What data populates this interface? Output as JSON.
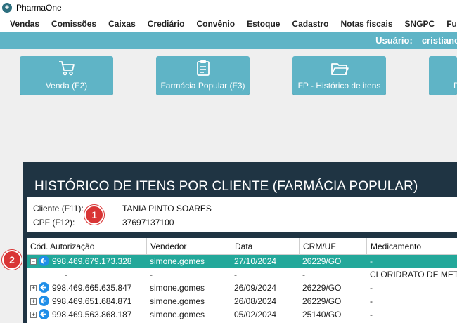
{
  "window": {
    "title": "PharmaOne"
  },
  "menu": [
    "Vendas",
    "Comissões",
    "Caixas",
    "Crediário",
    "Convênio",
    "Estoque",
    "Cadastro",
    "Notas fiscais",
    "SNGPC",
    "Funções a"
  ],
  "userbar": {
    "label": "Usuário:",
    "value": "cristiano"
  },
  "toolbar": {
    "buttons": [
      {
        "label": "Venda (F2)",
        "icon": "cart-icon"
      },
      {
        "label": "Farmácia Popular (F3)",
        "icon": "clipboard-icon"
      },
      {
        "label": "FP - Histórico de itens",
        "icon": "folder-icon"
      },
      {
        "label": "D",
        "icon": ""
      }
    ]
  },
  "panel": {
    "title": "HISTÓRICO DE ITENS POR CLIENTE (FARMÁCIA POPULAR)",
    "cliente_label": "Cliente (F11):",
    "cliente_value": "TANIA PINTO SOARES",
    "cpf_label": "CPF (F12):",
    "cpf_value": "37697137100"
  },
  "grid": {
    "columns": [
      "Cód. Autorização",
      "Vendedor",
      "Data",
      "CRM/UF",
      "Medicamento"
    ],
    "rows": [
      {
        "expander": "−",
        "cod": "998.469.679.173.328",
        "vendedor": "simone.gomes",
        "data": "27/10/2024",
        "crm": "26229/GO",
        "med": "-"
      },
      {
        "expander": "",
        "cod": "-",
        "vendedor": "-",
        "data": "-",
        "crm": "-",
        "med": "CLORIDRATO DE METFO"
      },
      {
        "expander": "+",
        "cod": "998.469.665.635.847",
        "vendedor": "simone.gomes",
        "data": "26/09/2024",
        "crm": "26229/GO",
        "med": "-"
      },
      {
        "expander": "+",
        "cod": "998.469.651.684.871",
        "vendedor": "simone.gomes",
        "data": "26/08/2024",
        "crm": "26229/GO",
        "med": "-"
      },
      {
        "expander": "+",
        "cod": "998.469.563.868.187",
        "vendedor": "simone.gomes",
        "data": "05/02/2024",
        "crm": "25140/GO",
        "med": "-"
      }
    ]
  },
  "badges": [
    "1",
    "2"
  ],
  "colors": {
    "accent": "#5fb4c6",
    "panel": "#1f3443",
    "selected_row": "#23a89a",
    "badge": "#d93535",
    "arrow_icon": "#1f8ee8"
  }
}
